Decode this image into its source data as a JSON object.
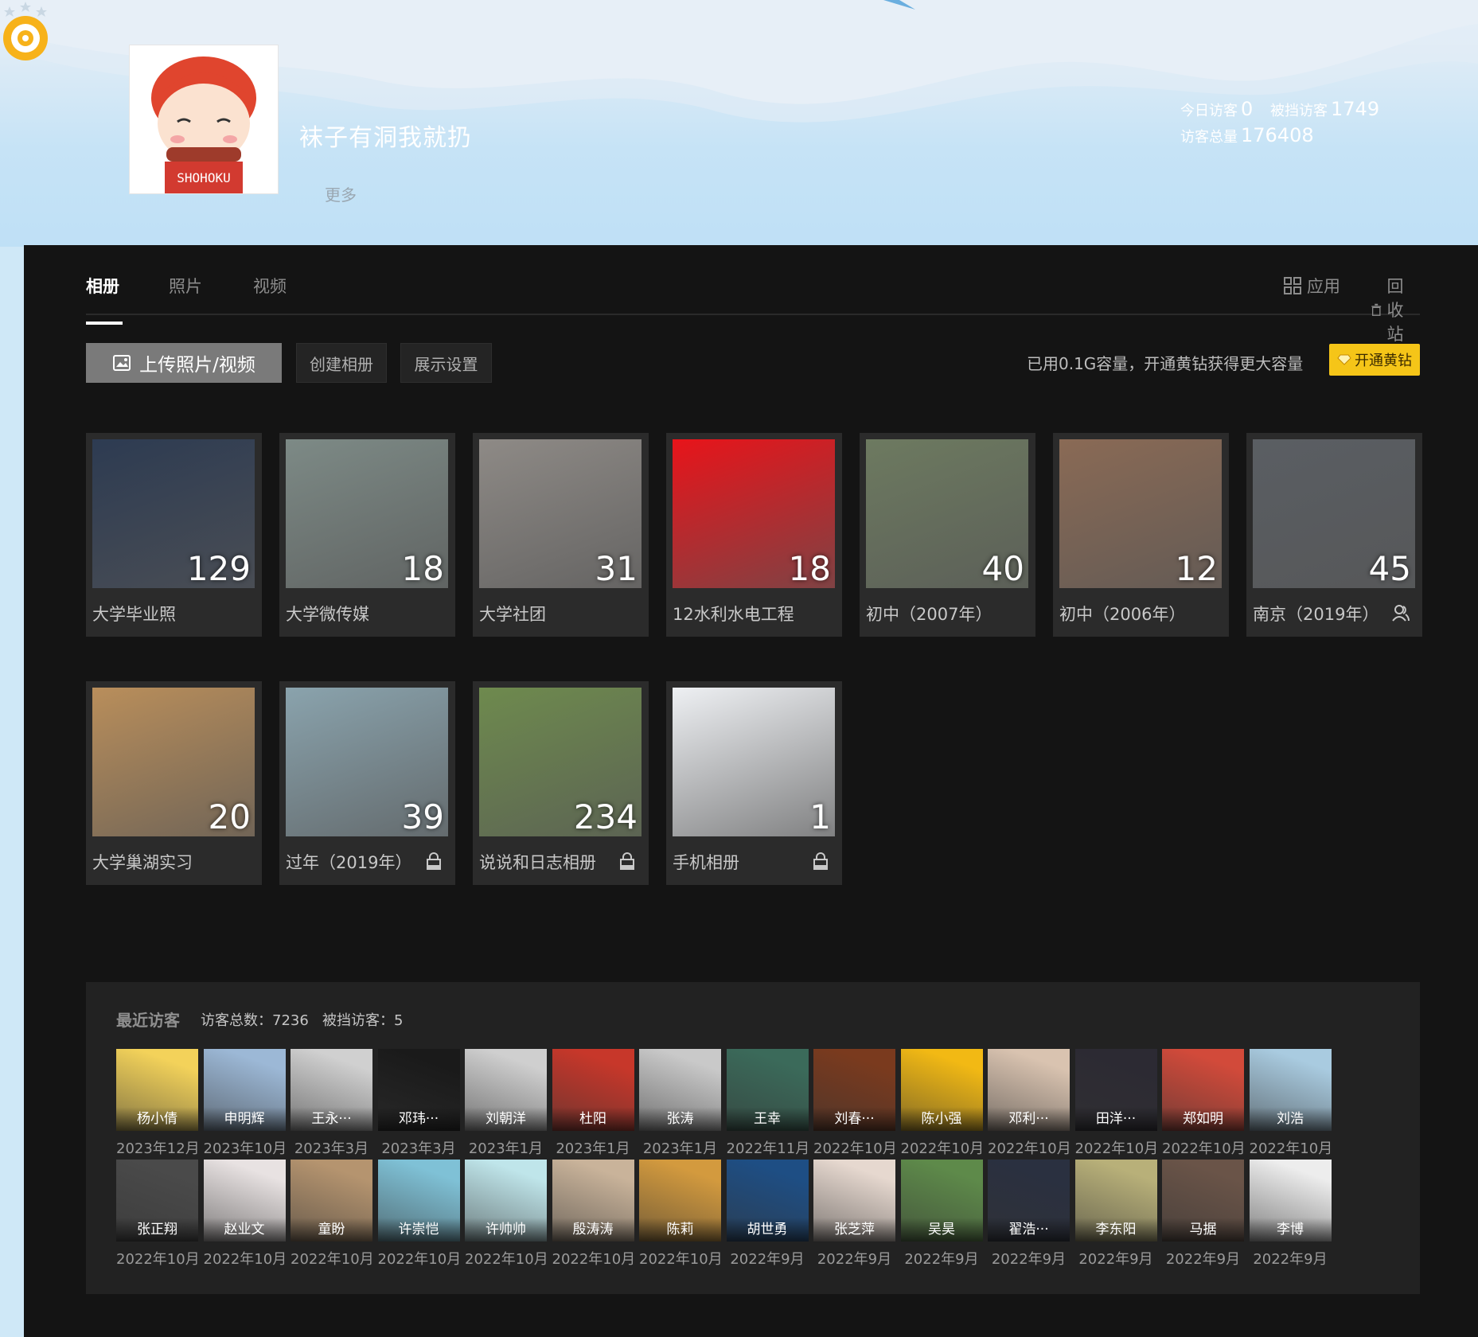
{
  "profile": {
    "nickname": "袜子有洞我就扔",
    "more_label": "更多"
  },
  "stats": {
    "today_label": "今日访客",
    "today_value": "0",
    "blocked_label": "被挡访客",
    "blocked_value": "1749",
    "total_label": "访客总量",
    "total_value": "176408"
  },
  "tabs": {
    "albums": "相册",
    "photos": "照片",
    "videos": "视频"
  },
  "tools": {
    "apps": "应用",
    "recycle": "回收站"
  },
  "actions": {
    "upload": "上传照片/视频",
    "create": "创建相册",
    "display": "展示设置"
  },
  "capacity": {
    "text": "已用0.1G容量，开通黄钻获得更大容量",
    "vip_label": "开通黄钻"
  },
  "albums": [
    {
      "name": "大学毕业照",
      "count": "129",
      "icon": "none",
      "color": "#2d3b52"
    },
    {
      "name": "大学微传媒",
      "count": "18",
      "icon": "none",
      "color": "#7d8a86"
    },
    {
      "name": "大学社团",
      "count": "31",
      "icon": "none",
      "color": "#8e8a86"
    },
    {
      "name": "12水利水电工程",
      "count": "18",
      "icon": "none",
      "color": "#e8141a"
    },
    {
      "name": "初中（2007年）",
      "count": "40",
      "icon": "none",
      "color": "#6d7a60"
    },
    {
      "name": "初中（2006年）",
      "count": "12",
      "icon": "none",
      "color": "#8a6a55"
    },
    {
      "name": "南京（2019年）",
      "count": "45",
      "icon": "people-icon",
      "color": "#5a5e63"
    },
    {
      "name": "大学巢湖实习",
      "count": "20",
      "icon": "none",
      "color": "#b98e5b"
    },
    {
      "name": "过年（2019年）",
      "count": "39",
      "icon": "lock-icon",
      "color": "#8aa3ad"
    },
    {
      "name": "说说和日志相册",
      "count": "234",
      "icon": "lock-icon",
      "color": "#6e8a4e"
    },
    {
      "name": "手机相册",
      "count": "1",
      "icon": "lock-icon",
      "color": "#eef0f3"
    }
  ],
  "visitors": {
    "title": "最近访客",
    "total": "访客总数：7236",
    "blocked": "被挡访客：5",
    "items": [
      {
        "name": "杨小倩",
        "date": "2023年12月",
        "color": "#f3d25a"
      },
      {
        "name": "申明辉",
        "date": "2023年10月",
        "color": "#9cb8d6"
      },
      {
        "name": "王永···",
        "date": "2023年3月",
        "color": "#d0d0d0"
      },
      {
        "name": "邓玮···",
        "date": "2023年3月",
        "color": "#1a1a1a"
      },
      {
        "name": "刘朝洋",
        "date": "2023年1月",
        "color": "#cfcfcf"
      },
      {
        "name": "杜阳",
        "date": "2023年1月",
        "color": "#c7372a"
      },
      {
        "name": "张涛",
        "date": "2023年1月",
        "color": "#c9c9c9"
      },
      {
        "name": "王幸",
        "date": "2022年11月",
        "color": "#3b6a5a"
      },
      {
        "name": "刘春···",
        "date": "2022年10月",
        "color": "#7a3a1e"
      },
      {
        "name": "陈小强",
        "date": "2022年10月",
        "color": "#f2b914"
      },
      {
        "name": "邓利···",
        "date": "2022年10月",
        "color": "#d9c3b0"
      },
      {
        "name": "田洋···",
        "date": "2022年10月",
        "color": "#2c2a33"
      },
      {
        "name": "郑如明",
        "date": "2022年10月",
        "color": "#d24a3a"
      },
      {
        "name": "刘浩",
        "date": "2022年10月",
        "color": "#a9cbe0"
      },
      {
        "name": "张正翔",
        "date": "2022年10月",
        "color": "#4a4a4a"
      },
      {
        "name": "赵业文",
        "date": "2022年10月",
        "color": "#e8e2e2"
      },
      {
        "name": "童盼",
        "date": "2022年10月",
        "color": "#b5946f"
      },
      {
        "name": "许崇恺",
        "date": "2022年10月",
        "color": "#7fc1d6"
      },
      {
        "name": "许帅帅",
        "date": "2022年10月",
        "color": "#bfe5ea"
      },
      {
        "name": "殷涛涛",
        "date": "2022年10月",
        "color": "#c9b39a"
      },
      {
        "name": "陈莉",
        "date": "2022年10月",
        "color": "#d39a3e"
      },
      {
        "name": "胡世勇",
        "date": "2022年9月",
        "color": "#1e4e84"
      },
      {
        "name": "张芝萍",
        "date": "2022年9月",
        "color": "#e6d8cf"
      },
      {
        "name": "吴昊",
        "date": "2022年9月",
        "color": "#5e8a4a"
      },
      {
        "name": "翟浩···",
        "date": "2022年9月",
        "color": "#2a3040"
      },
      {
        "name": "李东阳",
        "date": "2022年9月",
        "color": "#b8b079"
      },
      {
        "name": "马据",
        "date": "2022年9月",
        "color": "#6a5448"
      },
      {
        "name": "李博",
        "date": "2022年9月",
        "color": "#ededed"
      }
    ]
  }
}
